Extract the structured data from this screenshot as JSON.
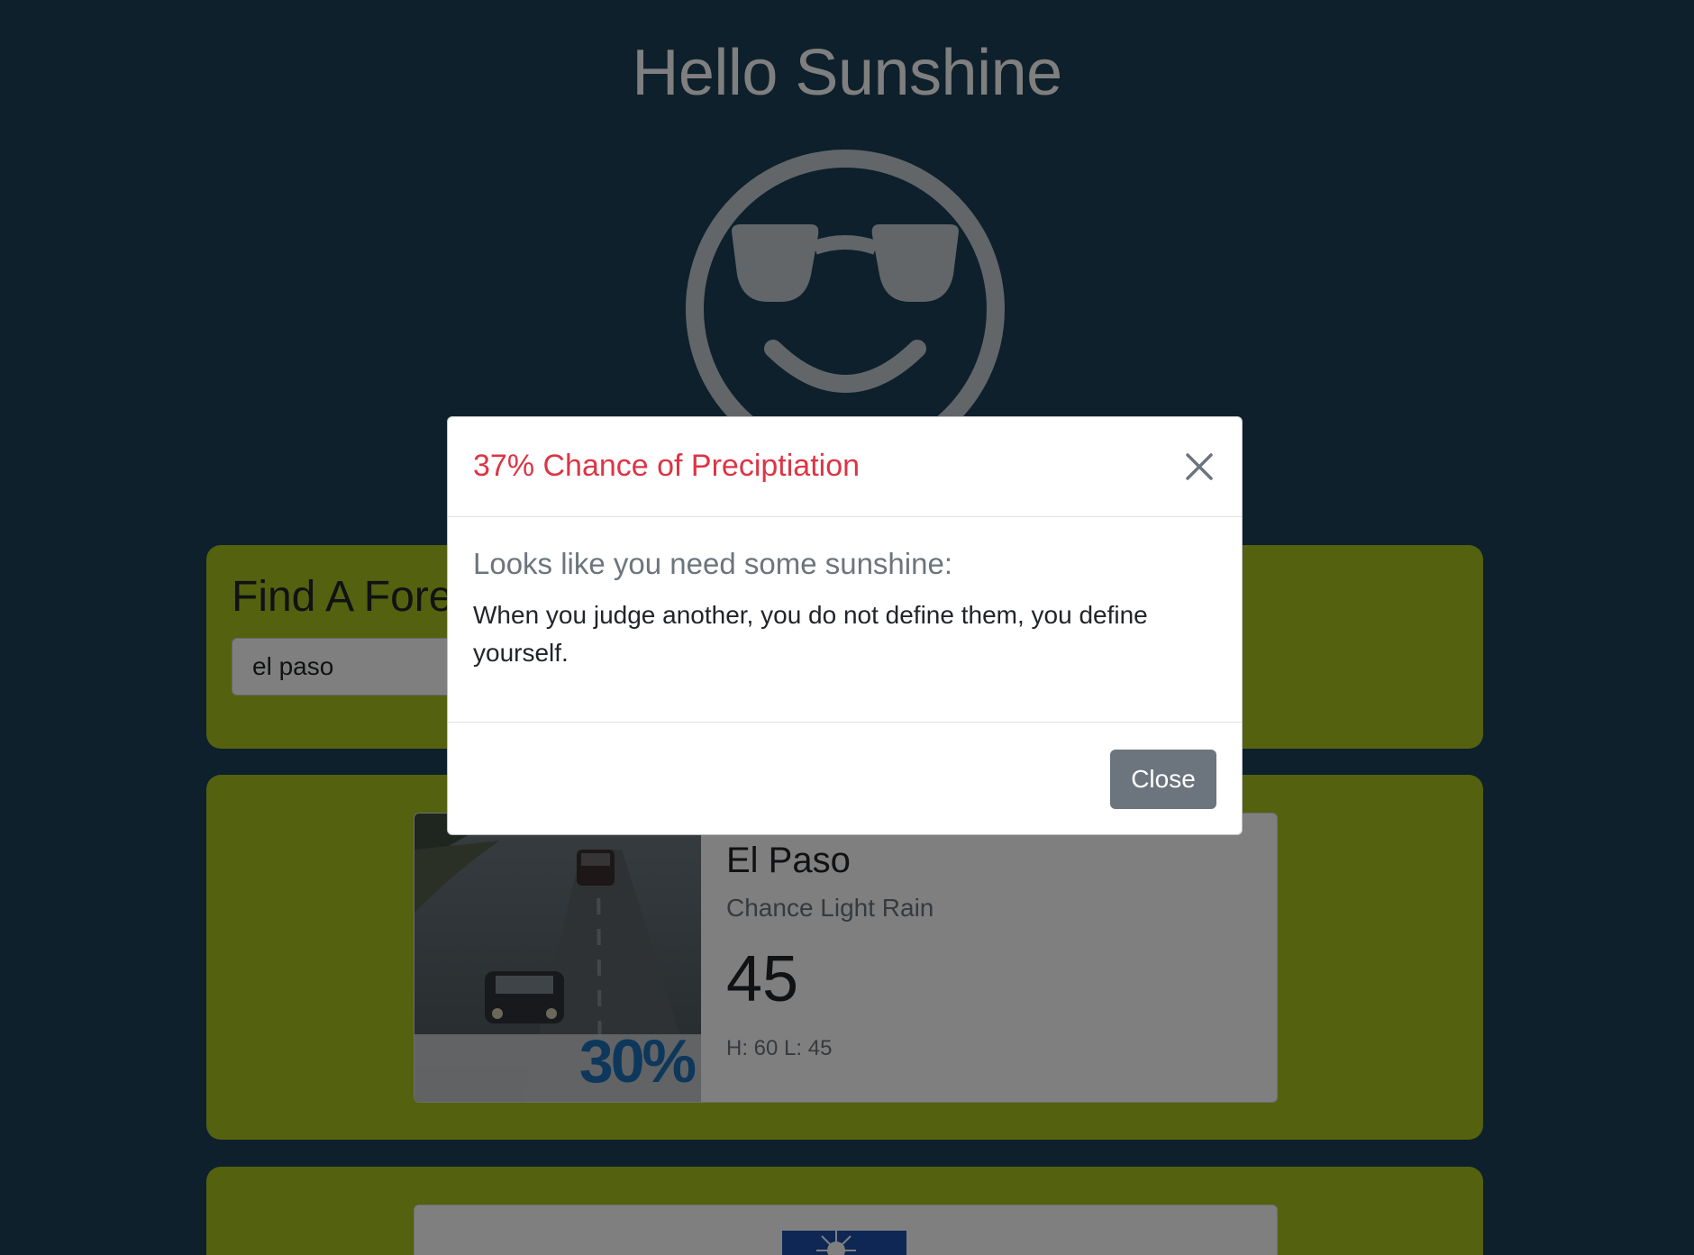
{
  "app": {
    "title": "Hello Sunshine",
    "logo_icon": "sunglasses-smiley-icon"
  },
  "search": {
    "heading": "Find A Forecast",
    "input_value": "el paso"
  },
  "forecast": {
    "image_icon": "rainy-road-image",
    "precip_overlay": "30%",
    "city": "El Paso",
    "condition": "Chance Light Rain",
    "temperature": "45",
    "hi_lo": "H: 60 L: 45"
  },
  "next_forecast": {
    "image_icon": "sunny-sky-image"
  },
  "modal": {
    "title": "37% Chance of Preciptiation",
    "subtitle": "Looks like you need some sunshine:",
    "quote": "When you judge another, you do not define them, you define yourself.",
    "close_button": "Close",
    "close_icon": "close-icon"
  },
  "colors": {
    "page_background": "#1a4059",
    "panel_background": "#a8c21e",
    "modal_title": "#dc3545",
    "secondary_button": "#6c757d"
  }
}
